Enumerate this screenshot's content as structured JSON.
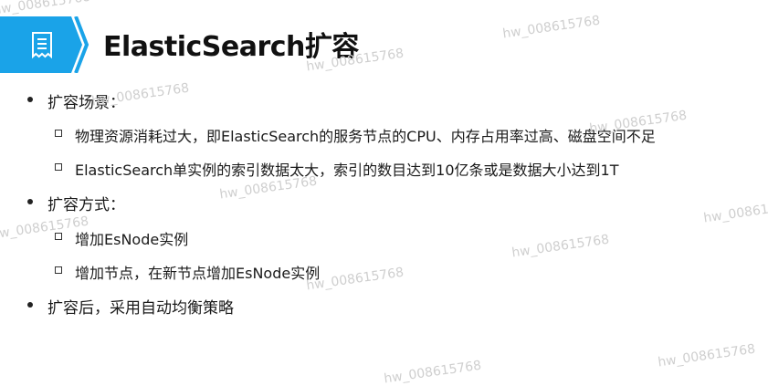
{
  "slide": {
    "title": "ElasticSearch扩容",
    "accent_color": "#1aa3e8",
    "header_icon": "receipt-document-icon",
    "bullets": [
      {
        "text": "扩容场景：",
        "children": [
          "物理资源消耗过大，即ElasticSearch的服务节点的CPU、内存占用率过高、磁盘空间不足",
          "ElasticSearch单实例的索引数据太大，索引的数目达到10亿条或是数据大小达到1T"
        ]
      },
      {
        "text": "扩容方式：",
        "children": [
          "增加EsNode实例",
          "增加节点，在新节点增加EsNode实例"
        ]
      },
      {
        "text": "扩容后，采用自动均衡策略",
        "children": []
      }
    ]
  },
  "watermark": "hw_008615768"
}
